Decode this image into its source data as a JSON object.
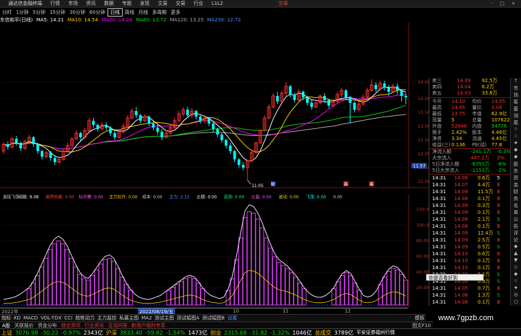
{
  "menu": {
    "app": "通达信金融终端",
    "items": [
      "行情",
      "市场",
      "资讯",
      "数据",
      "专题",
      "发现",
      "文易",
      "交易",
      "行业",
      "L1L2"
    ],
    "trade": "交易",
    "winbtns": "- □ ×"
  },
  "period": {
    "items": [
      "分时",
      "1分钟",
      "5分钟",
      "15分钟",
      "30分钟",
      "60分钟",
      "日线",
      "周线",
      "月线",
      "多周期",
      "更多"
    ],
    "active": "日线"
  },
  "ma": {
    "stock": "东信和平(日线)",
    "ma5": "MA5: 14.21",
    "ma10": "MA10: 14.54",
    "ma20": "MA20: 14.24",
    "ma60": "MA60: 13.72",
    "ma120": "MA120: 13.25",
    "extra": "MA250: 12.72"
  },
  "colors": {
    "up": "#ff3030",
    "down": "#00ffff",
    "ma5": "#ffffff",
    "ma10": "#ffd000",
    "ma20": "#ff00ff",
    "ma60": "#00d000",
    "ma120": "#aaaaaa"
  },
  "price_axis": {
    "labels": [
      "14.60",
      "14.00",
      "13.50",
      "13.00",
      "12.50",
      "12.00",
      "11.50",
      "11.00"
    ],
    "current": "11.57"
  },
  "chart_data": {
    "type": "candlestick",
    "price_ylim": [
      10.85,
      14.75
    ],
    "low_annotation": "11.05",
    "markers": [
      "财",
      "商",
      "商"
    ],
    "candles": [
      [
        12.1,
        12.35,
        12.0,
        12.4
      ],
      [
        12.35,
        12.25,
        12.15,
        12.45
      ],
      [
        12.25,
        12.55,
        12.2,
        12.6
      ],
      [
        12.55,
        12.4,
        12.3,
        12.65
      ],
      [
        12.4,
        12.2,
        12.1,
        12.45
      ],
      [
        12.2,
        12.45,
        12.15,
        12.5
      ],
      [
        12.45,
        12.6,
        12.35,
        12.7
      ],
      [
        12.6,
        12.35,
        12.25,
        12.65
      ],
      [
        12.35,
        12.1,
        12.0,
        12.4
      ],
      [
        12.1,
        11.9,
        11.8,
        12.15
      ],
      [
        11.9,
        12.05,
        11.85,
        12.1
      ],
      [
        12.05,
        11.85,
        11.75,
        12.1
      ],
      [
        11.85,
        11.7,
        11.6,
        11.95
      ],
      [
        11.7,
        11.8,
        11.65,
        11.9
      ],
      [
        11.8,
        12.1,
        11.75,
        12.15
      ],
      [
        12.1,
        12.3,
        12.05,
        12.4
      ],
      [
        12.3,
        12.55,
        12.25,
        12.6
      ],
      [
        12.55,
        12.75,
        12.5,
        12.85
      ],
      [
        12.75,
        12.6,
        12.45,
        12.8
      ],
      [
        12.6,
        12.85,
        12.55,
        12.95
      ],
      [
        12.85,
        13.2,
        12.8,
        13.3
      ],
      [
        13.2,
        13.05,
        12.95,
        13.3
      ],
      [
        13.05,
        12.9,
        12.8,
        13.1
      ],
      [
        12.9,
        13.05,
        12.85,
        13.15
      ],
      [
        13.05,
        12.95,
        12.85,
        13.15
      ],
      [
        12.95,
        12.75,
        12.65,
        13.0
      ],
      [
        12.75,
        12.6,
        12.5,
        12.85
      ],
      [
        12.6,
        12.8,
        12.55,
        12.9
      ],
      [
        12.8,
        13.0,
        12.75,
        13.1
      ],
      [
        13.0,
        13.3,
        12.95,
        13.4
      ],
      [
        13.3,
        13.55,
        13.25,
        13.65
      ],
      [
        13.55,
        13.4,
        13.3,
        13.7
      ],
      [
        13.4,
        13.2,
        13.1,
        13.45
      ],
      [
        13.2,
        13.35,
        13.15,
        13.45
      ],
      [
        13.35,
        13.1,
        13.0,
        13.4
      ],
      [
        13.1,
        12.95,
        12.85,
        13.2
      ],
      [
        12.95,
        12.8,
        12.7,
        13.05
      ],
      [
        12.8,
        12.6,
        12.5,
        12.9
      ],
      [
        12.6,
        12.75,
        12.55,
        12.85
      ],
      [
        12.75,
        12.95,
        12.7,
        13.05
      ],
      [
        12.95,
        13.2,
        12.9,
        13.3
      ],
      [
        13.2,
        13.45,
        13.15,
        13.55
      ],
      [
        13.45,
        13.6,
        13.35,
        13.7
      ],
      [
        13.6,
        13.4,
        13.3,
        13.7
      ],
      [
        13.4,
        13.55,
        13.3,
        13.65
      ],
      [
        13.55,
        13.35,
        13.25,
        13.6
      ],
      [
        13.35,
        13.2,
        13.1,
        13.4
      ],
      [
        13.2,
        13.3,
        13.1,
        13.4
      ],
      [
        13.3,
        13.1,
        13.0,
        13.35
      ],
      [
        13.1,
        12.9,
        12.8,
        13.15
      ],
      [
        12.9,
        12.7,
        12.6,
        12.95
      ],
      [
        12.7,
        12.5,
        12.4,
        12.75
      ],
      [
        12.5,
        12.3,
        12.2,
        12.55
      ],
      [
        12.3,
        12.1,
        12.0,
        12.4
      ],
      [
        12.1,
        11.8,
        11.7,
        12.15
      ],
      [
        11.8,
        11.6,
        11.5,
        11.85
      ],
      [
        11.6,
        11.5,
        11.4,
        11.7
      ],
      [
        11.5,
        11.75,
        11.05,
        11.8
      ],
      [
        11.75,
        12.05,
        11.7,
        12.1
      ],
      [
        12.05,
        12.4,
        12.0,
        12.45
      ],
      [
        12.4,
        12.85,
        12.35,
        12.9
      ],
      [
        12.85,
        13.3,
        12.8,
        13.4
      ],
      [
        13.3,
        13.7,
        13.25,
        13.8
      ],
      [
        13.7,
        14.1,
        13.65,
        14.2
      ],
      [
        14.1,
        13.9,
        13.8,
        14.25
      ],
      [
        13.9,
        14.2,
        13.85,
        14.3
      ],
      [
        14.2,
        14.45,
        14.1,
        14.6
      ],
      [
        14.45,
        14.15,
        14.05,
        14.5
      ],
      [
        14.15,
        13.95,
        13.85,
        14.2
      ],
      [
        13.95,
        14.25,
        13.9,
        14.35
      ],
      [
        14.25,
        14.05,
        13.95,
        14.3
      ],
      [
        14.05,
        13.85,
        13.75,
        14.1
      ],
      [
        13.85,
        13.7,
        13.6,
        13.95
      ],
      [
        13.7,
        13.85,
        13.65,
        13.95
      ],
      [
        13.85,
        14.1,
        13.8,
        14.15
      ],
      [
        14.1,
        13.95,
        13.85,
        14.2
      ],
      [
        13.95,
        13.75,
        13.65,
        14.0
      ],
      [
        13.75,
        13.9,
        13.7,
        14.0
      ],
      [
        13.9,
        14.15,
        13.85,
        14.25
      ],
      [
        14.15,
        14.3,
        14.05,
        14.4
      ],
      [
        14.3,
        14.05,
        13.95,
        14.35
      ],
      [
        14.05,
        13.85,
        13.1,
        14.1
      ],
      [
        13.85,
        13.6,
        13.5,
        13.9
      ],
      [
        13.6,
        13.8,
        13.55,
        13.9
      ],
      [
        13.8,
        14.05,
        13.75,
        14.15
      ],
      [
        14.05,
        14.3,
        14.0,
        14.4
      ],
      [
        14.3,
        14.5,
        14.25,
        14.7
      ],
      [
        14.5,
        14.35,
        14.25,
        14.6
      ],
      [
        14.35,
        14.55,
        14.3,
        14.65
      ],
      [
        14.55,
        14.4,
        14.3,
        14.65
      ],
      [
        14.4,
        14.25,
        14.1,
        14.5
      ],
      [
        14.25,
        14.45,
        14.2,
        14.55
      ],
      [
        14.45,
        14.3,
        14.15,
        14.55
      ],
      [
        14.3,
        14.1,
        13.9,
        14.35
      ],
      [
        14.1,
        14.05,
        13.8,
        14.2
      ]
    ],
    "lower": {
      "legend": [
        "波段飞涨",
        "动能: 9.08",
        "趋势热度: 0.00",
        "标兵赛: 0.00",
        "主力拉升: 0.00",
        "成本: 0.00",
        "主力: 2.15",
        "止损: 0.00",
        "底部: 0.00",
        "止盈: 0.00",
        "波动: 0.00",
        "飞涨: 0.00",
        "0.00"
      ],
      "axis_labels": [
        "120.00",
        "100.00",
        "80.00",
        "60.00",
        "40.00",
        "20.00"
      ],
      "ylim": [
        -2,
        132
      ],
      "line": [
        5,
        6,
        7,
        9,
        12,
        16,
        20,
        28,
        38,
        50,
        62,
        74,
        82,
        86,
        82,
        74,
        62,
        50,
        40,
        34,
        32,
        38,
        46,
        54,
        60,
        62,
        58,
        48,
        36,
        26,
        18,
        12,
        8,
        6,
        5,
        6,
        8,
        10,
        14,
        18,
        22,
        26,
        30,
        34,
        36,
        34,
        28,
        20,
        14,
        10,
        8,
        6,
        8,
        18,
        34,
        60,
        90,
        118,
        126,
        124,
        116,
        104,
        90,
        76,
        64,
        56,
        52,
        48,
        42,
        36,
        28,
        20,
        14,
        10,
        8,
        8,
        10,
        14,
        20,
        30,
        38,
        42,
        38,
        28,
        18,
        10,
        8,
        10,
        16,
        26,
        36,
        44,
        48,
        46,
        40,
        32
      ]
    },
    "x_labels": [
      "2022年",
      "2022/08/19/五",
      "10",
      "11",
      "12"
    ]
  },
  "quote": {
    "rows": [
      [
        "卖三",
        "14.09",
        "92.5万"
      ],
      [
        "卖四",
        "14.04",
        "6.2万"
      ],
      [
        "卖五",
        "14.03",
        "33.8万"
      ]
    ],
    "stats": [
      [
        "今开",
        "14.10",
        "均价",
        "14.05"
      ],
      [
        "最高",
        "14.45",
        "量比",
        "1.04"
      ],
      [
        "最低",
        "13.75",
        "市值",
        "62.9亿"
      ],
      [
        "现量",
        "5",
        "总量",
        "107622"
      ],
      [
        "外盘",
        "52846",
        "内盘",
        "54776"
      ],
      [
        "换手",
        "2.42%",
        "股本",
        "4.46亿"
      ],
      [
        "净资",
        "3.34",
        "流通",
        "4.45亿"
      ],
      [
        "收益(三)",
        "0.136",
        "PE(动)",
        "77.8"
      ]
    ],
    "flows": [
      [
        "净流入额",
        "-241.1万",
        "-0.3%"
      ],
      [
        "大宗流入",
        "447.2万",
        "3%"
      ],
      [
        "5日净流入额",
        "-6355万",
        "-8%"
      ],
      [
        "5日大宗流入",
        "-1153万",
        "-2%"
      ]
    ]
  },
  "ticks": [
    [
      "14:31",
      "14.06",
      "0.6万",
      "5"
    ],
    [
      "14:31",
      "14.07",
      "4.4万",
      "B"
    ],
    [
      "14:31",
      "14.08",
      "11.5万",
      "B"
    ],
    [
      "14:31",
      "14.08",
      "0.1万",
      "B"
    ],
    [
      "14:31",
      "14.09",
      "0.3万",
      "B"
    ],
    [
      "14:31",
      "14.09",
      "0.1万",
      "B"
    ],
    [
      "14:31",
      "14.08",
      "2.1万",
      "S"
    ],
    [
      "14:31",
      "14.08",
      "0.1万",
      "B"
    ],
    [
      "14:31",
      "14.09",
      "12.4万",
      "S"
    ],
    [
      "14:31",
      "14.09",
      "2.5万",
      "B"
    ],
    [
      "14:31",
      "14.09",
      "0.5万",
      "S"
    ],
    [
      "14:31",
      "14.10",
      "0.6万",
      "B"
    ],
    [
      "14:31",
      "14.10",
      "0.1万",
      "B"
    ],
    [
      "14:31",
      "14.10",
      "0.1万",
      "B"
    ],
    [
      "14:31",
      "14.09",
      "0.1万",
      "S"
    ],
    [
      "14:31",
      "14.06",
      "0.9万",
      "S"
    ],
    [
      "14:31",
      "14.05",
      "0.7万",
      "B"
    ],
    [
      "14:31",
      "14.06",
      "1.3万",
      "S"
    ],
    [
      "14:31",
      "14.08",
      "0.1万",
      "B"
    ]
  ],
  "rightedge": [
    "↑",
    "市",
    "场",
    "筹",
    "基",
    "测",
    "尾",
    "☆",
    "☆",
    "★",
    "◆",
    "◆",
    "股",
    "东",
    "资",
    "金",
    "财",
    "务",
    "名",
    "单",
    "公",
    "告",
    "评",
    "论",
    "◆",
    "▲",
    "▼",
    "◇",
    "◆",
    "☆",
    "★",
    "◎",
    "○"
  ],
  "subtoolbar": {
    "items": [
      "指标",
      "KD",
      "MACD",
      "VOL-TDX",
      "CCI",
      "趋势动力",
      "主力监控",
      "私募主图",
      "MA2",
      "测试主图",
      "测试幅图A",
      "测试幅图B",
      "设置"
    ],
    "active": "设置",
    "right": "模板"
  },
  "tabbar": {
    "items": [
      "A股",
      "关联报价",
      "资金分布",
      "综合资讯",
      "行业资讯",
      "互动问答",
      "新用户福利专享"
    ],
    "right": "图文F10"
  },
  "status": [
    [
      "上证",
      "3076.98",
      "-30.22",
      "-0.97%",
      "2343亿"
    ],
    [
      "沪深",
      "3833.40",
      "-59.82",
      "-1.54%",
      "1473亿"
    ],
    [
      "创业",
      "2315.68",
      "-31.82",
      "-1.32%",
      "1046亿"
    ],
    [
      "总成交",
      "",
      "",
      "",
      "3789亿"
    ]
  ],
  "status_tail": "平安证券福州行情",
  "toast": "你是否看好到",
  "watermark": "www.7gpzb.com"
}
